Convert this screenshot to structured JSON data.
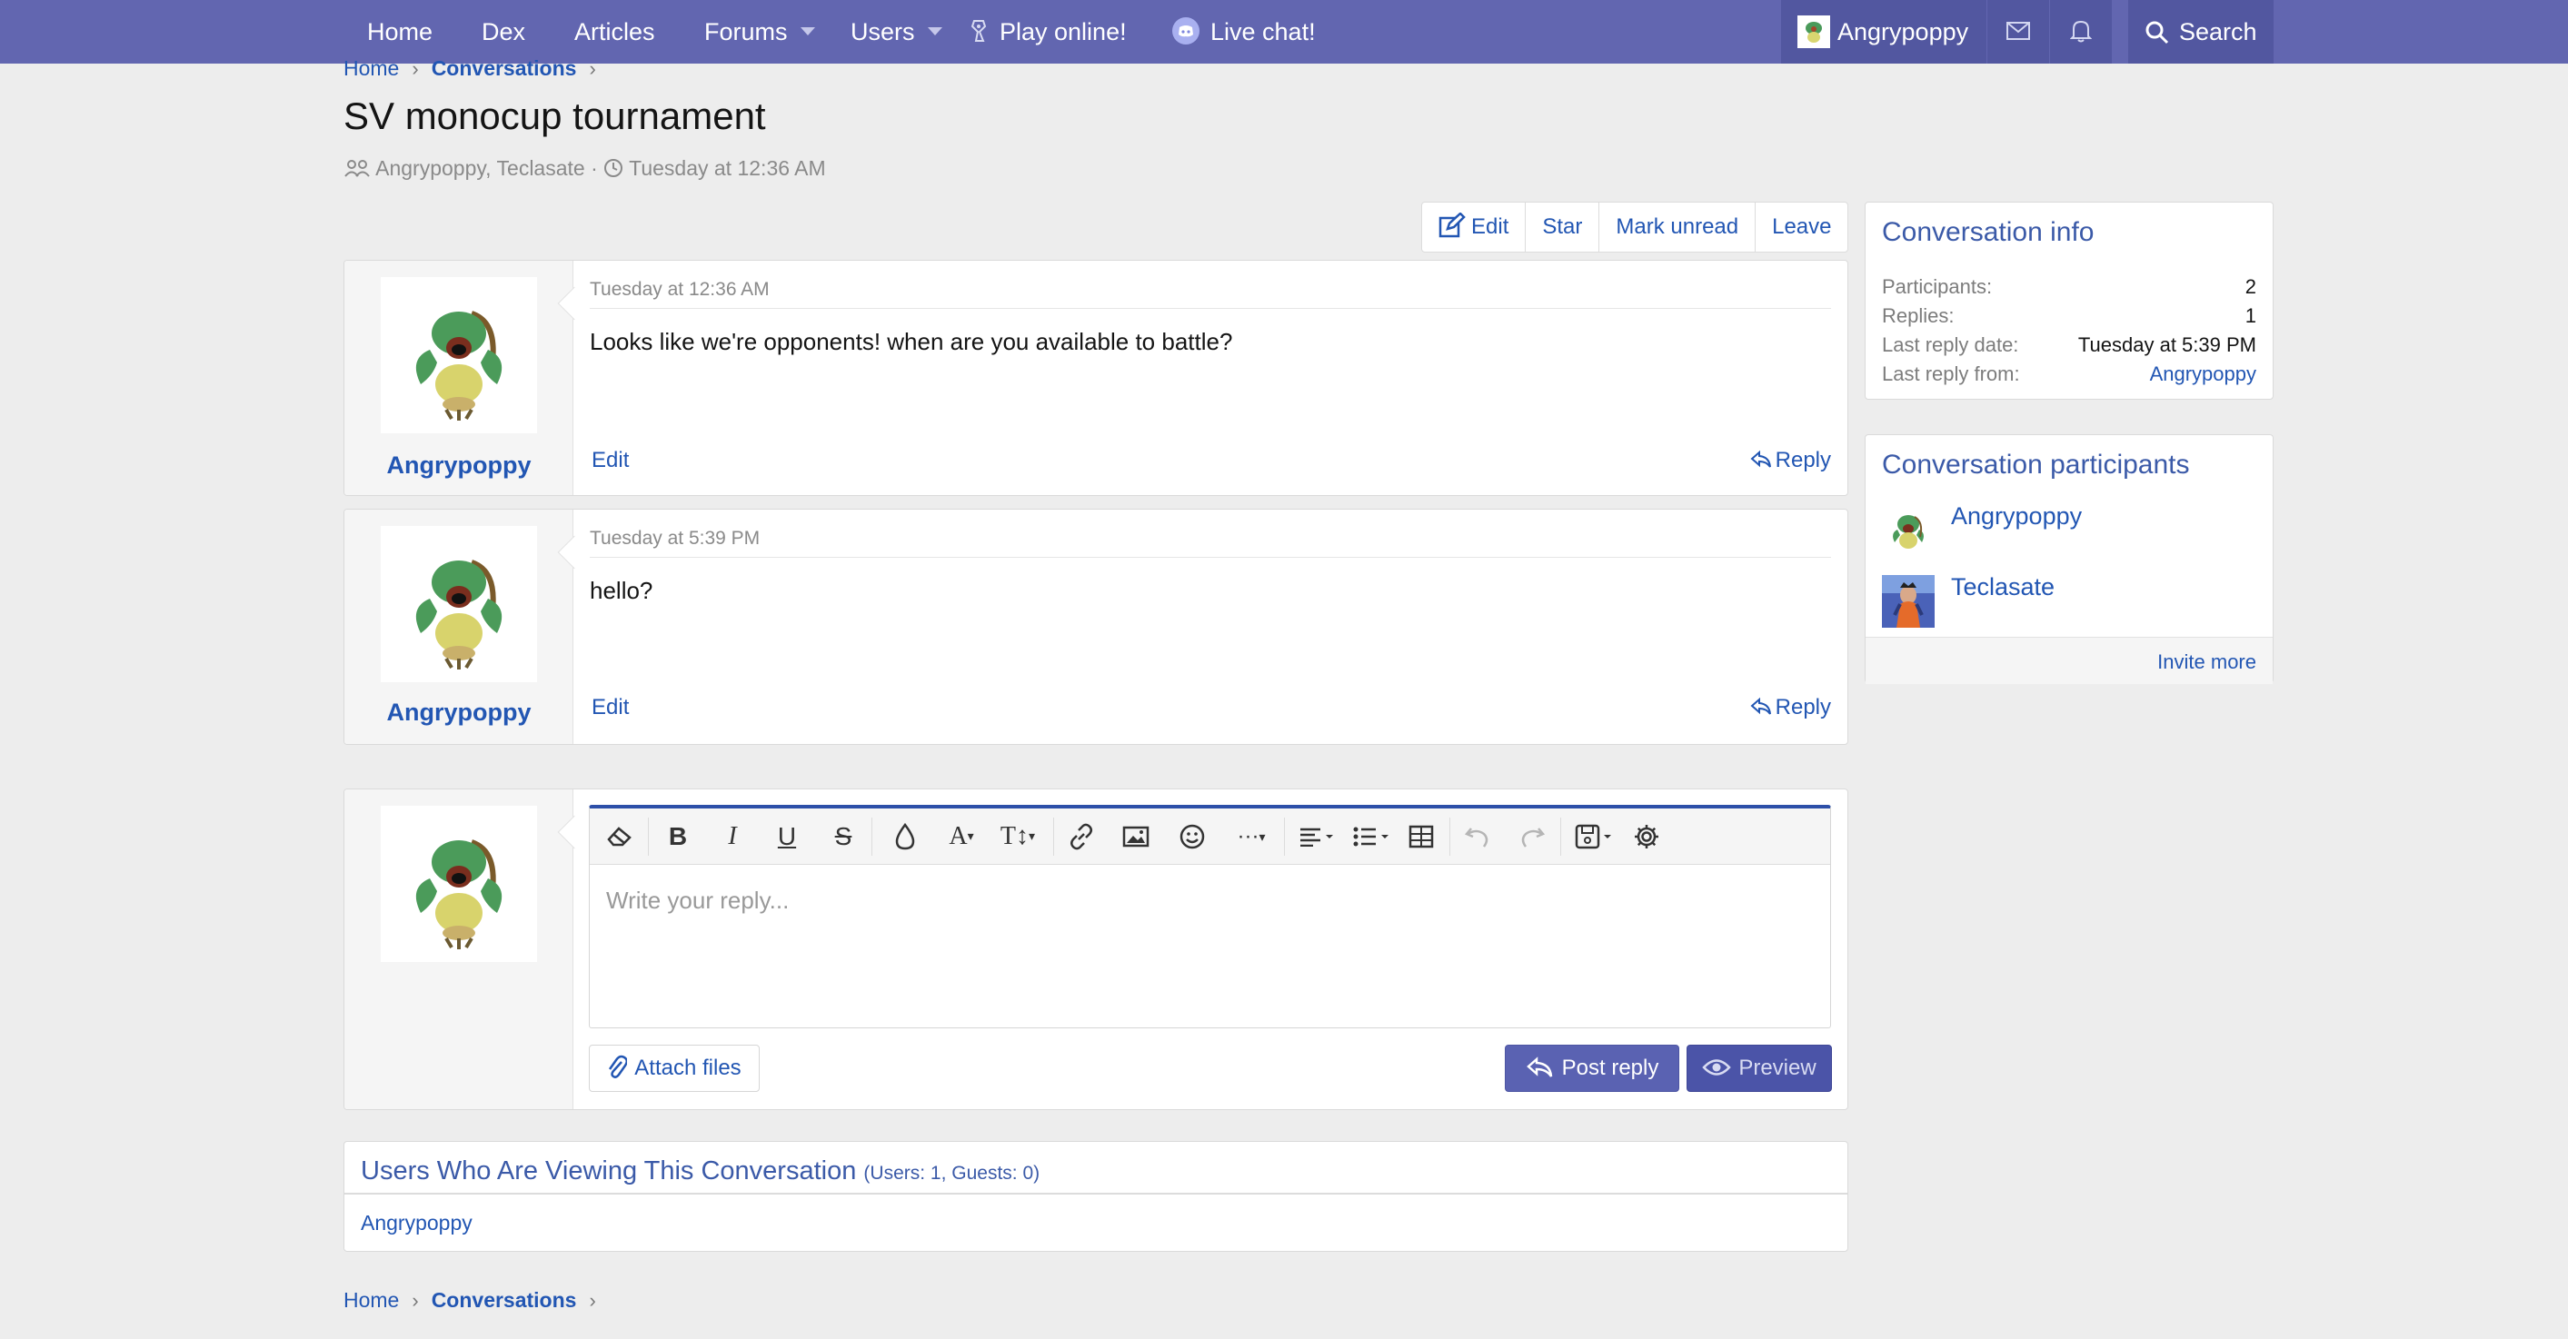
{
  "nav": {
    "items": [
      "Home",
      "Dex",
      "Articles",
      "Forums",
      "Users",
      "Play online!",
      "Live chat!"
    ],
    "username": "Angrypoppy",
    "search": "Search"
  },
  "breadcrumb": {
    "home": "Home",
    "current": "Conversations"
  },
  "title": "SV monocup tournament",
  "meta": {
    "participants": "Angrypoppy, Teclasate",
    "time": "Tuesday at 12:36 AM"
  },
  "actions": {
    "edit": "Edit",
    "star": "Star",
    "mark_unread": "Mark unread",
    "leave": "Leave"
  },
  "messages": [
    {
      "user": "Angrypoppy",
      "time": "Tuesday at 12:36 AM",
      "body": "Looks like we're opponents! when are you available to battle?",
      "edit": "Edit",
      "reply": "Reply"
    },
    {
      "user": "Angrypoppy",
      "time": "Tuesday at 5:39 PM",
      "body": "hello?",
      "edit": "Edit",
      "reply": "Reply"
    }
  ],
  "editor": {
    "placeholder": "Write your reply...",
    "attach": "Attach files",
    "post": "Post reply",
    "preview": "Preview"
  },
  "info": {
    "title": "Conversation info",
    "rows": [
      {
        "k": "Participants:",
        "v": "2"
      },
      {
        "k": "Replies:",
        "v": "1"
      },
      {
        "k": "Last reply date:",
        "v": "Tuesday at 5:39 PM"
      },
      {
        "k": "Last reply from:",
        "v": "Angrypoppy"
      }
    ]
  },
  "participants": {
    "title": "Conversation participants",
    "users": [
      "Angrypoppy",
      "Teclasate"
    ],
    "invite": "Invite more"
  },
  "viewers": {
    "title": "Users Who Are Viewing This Conversation",
    "counts": "(Users: 1, Guests: 0)",
    "user": "Angrypoppy"
  },
  "colors": {
    "navbar": "#6266b0",
    "link": "#2256b3",
    "accent": "#2d4fa8",
    "primary_button": "#5a62b2"
  }
}
